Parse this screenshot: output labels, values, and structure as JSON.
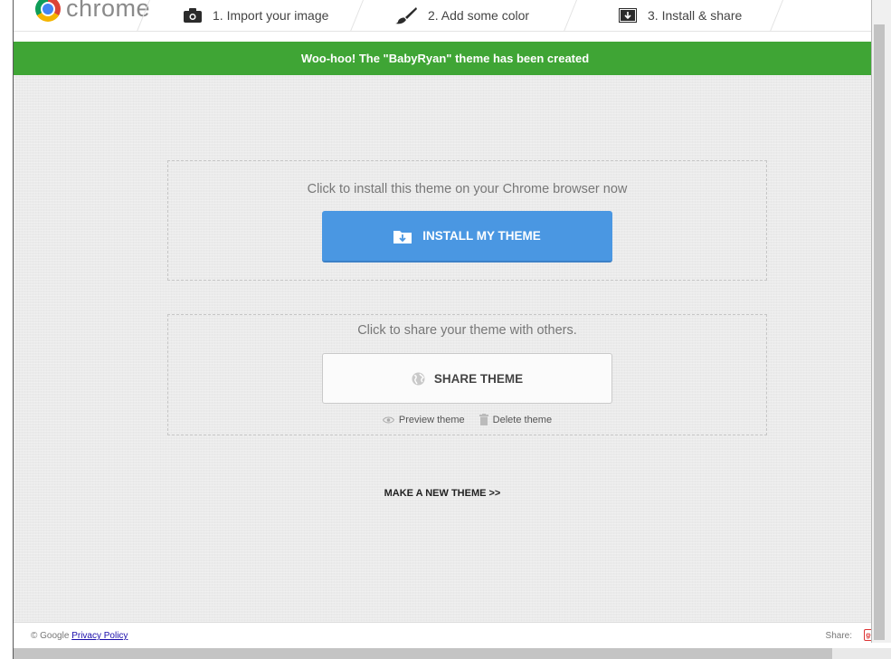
{
  "header": {
    "logo_text": "chrome",
    "steps": [
      {
        "label": "1. Import your image",
        "icon": "camera-icon"
      },
      {
        "label": "2. Add some color",
        "icon": "paintbrush-icon"
      },
      {
        "label": "3. Install & share",
        "icon": "download-box-icon"
      }
    ]
  },
  "banner": {
    "message": "Woo-hoo! The \"BabyRyan\" theme has been created",
    "color": "#3fa535"
  },
  "install": {
    "prompt": "Click to install this theme on your Chrome browser now",
    "button_label": "INSTALL MY THEME",
    "button_icon": "folder-download-icon",
    "button_color": "#4a97e2"
  },
  "share": {
    "prompt": "Click to share your theme with others.",
    "button_label": "SHARE THEME",
    "button_icon": "globe-icon",
    "preview_label": "Preview theme",
    "preview_icon": "eye-icon",
    "delete_label": "Delete theme",
    "delete_icon": "trash-icon"
  },
  "make_new_label": "MAKE A NEW THEME >>",
  "footer": {
    "copyright": "© Google",
    "privacy_label": "Privacy Policy",
    "share_label": "Share:",
    "gplus_icon": "google-plus-icon",
    "gplus_text": "g+"
  }
}
